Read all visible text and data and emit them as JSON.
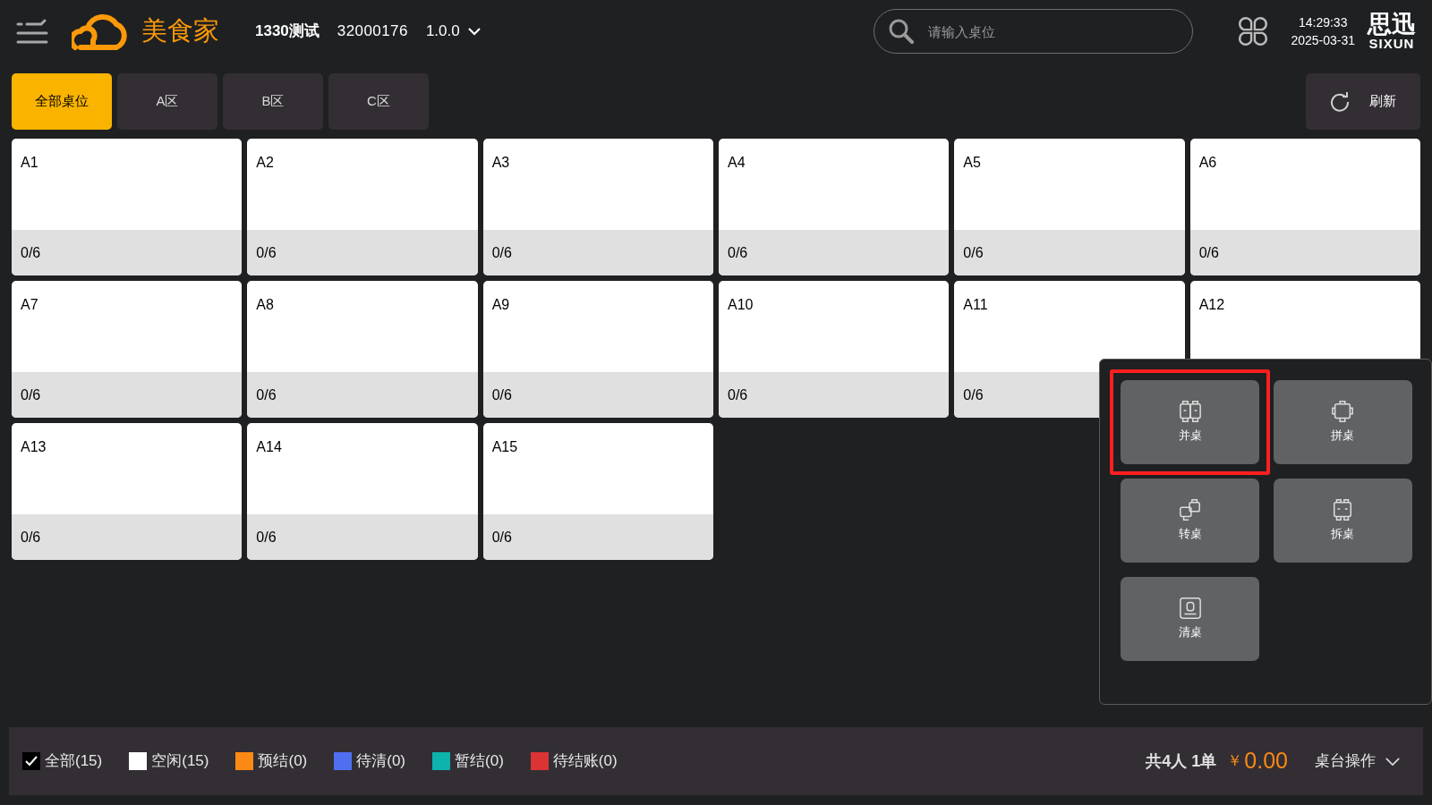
{
  "header": {
    "app_name": "美食家",
    "store_name": "1330测试",
    "store_code": "32000176",
    "version": "1.0.0",
    "search": {
      "placeholder": "请输入桌位"
    },
    "time": "14:29:33",
    "date": "2025-03-31",
    "brand": {
      "cn": "思迅",
      "en": "SIXUN"
    }
  },
  "area_tabs": [
    {
      "label": "全部桌位",
      "selected": true
    },
    {
      "label": "A区",
      "selected": false
    },
    {
      "label": "B区",
      "selected": false
    },
    {
      "label": "C区",
      "selected": false
    }
  ],
  "refresh_button": "刷新",
  "tables": [
    {
      "name": "A1",
      "count": "0/6"
    },
    {
      "name": "A2",
      "count": "0/6"
    },
    {
      "name": "A3",
      "count": "0/6"
    },
    {
      "name": "A4",
      "count": "0/6"
    },
    {
      "name": "A5",
      "count": "0/6"
    },
    {
      "name": "A6",
      "count": "0/6"
    },
    {
      "name": "A7",
      "count": "0/6"
    },
    {
      "name": "A8",
      "count": "0/6"
    },
    {
      "name": "A9",
      "count": "0/6"
    },
    {
      "name": "A10",
      "count": "0/6"
    },
    {
      "name": "A11",
      "count": "0/6"
    },
    {
      "name": "A12"
    },
    {
      "name": "A13",
      "count": "0/6"
    },
    {
      "name": "A14",
      "count": "0/6"
    },
    {
      "name": "A15",
      "count": "0/6"
    }
  ],
  "table_actions": [
    {
      "kind": "merge",
      "label": "并桌",
      "highlighted": true
    },
    {
      "kind": "join",
      "label": "拼桌",
      "highlighted": false
    },
    {
      "kind": "transfer",
      "label": "转桌",
      "highlighted": false
    },
    {
      "kind": "split",
      "label": "拆桌",
      "highlighted": false
    },
    {
      "kind": "clear",
      "label": "清桌",
      "highlighted": false
    }
  ],
  "status_bar": {
    "legend": [
      {
        "kind": "checkbox",
        "label": "全部(15)",
        "checked": true
      },
      {
        "kind": "swatch",
        "label": "空闲(15)",
        "color": "#ffffff"
      },
      {
        "kind": "swatch",
        "label": "预结(0)",
        "color": "#fb8a14"
      },
      {
        "kind": "swatch",
        "label": "待清(0)",
        "color": "#4f6ef0"
      },
      {
        "kind": "swatch",
        "label": "暂结(0)",
        "color": "#0db3ad"
      },
      {
        "kind": "swatch",
        "label": "待结账(0)",
        "color": "#dc3434"
      }
    ],
    "summary": "共4人 1单",
    "currency": "￥",
    "amount": "0.00",
    "operations_button": "桌台操作"
  }
}
